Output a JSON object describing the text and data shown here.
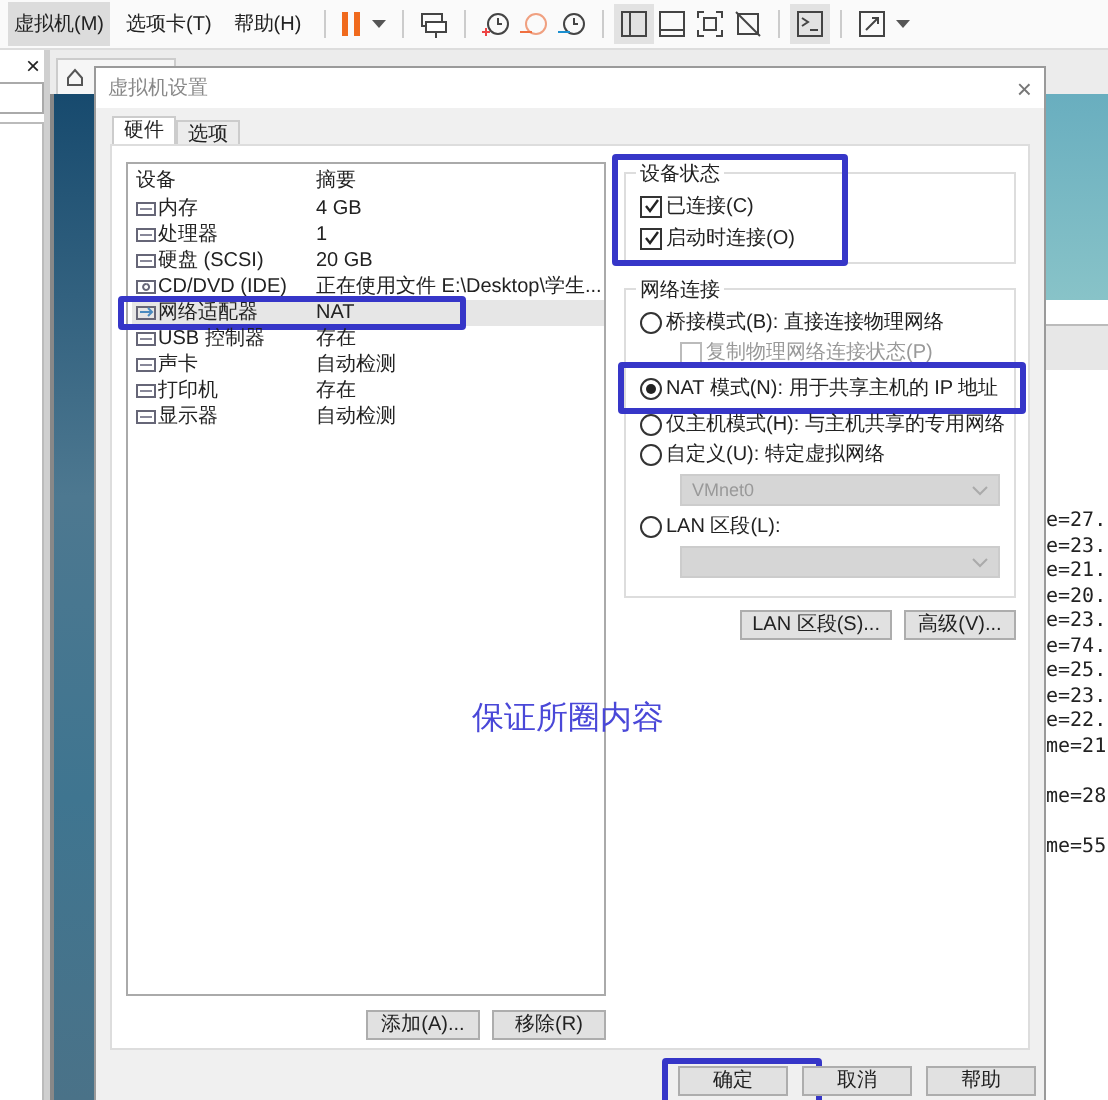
{
  "menu_bar": {
    "items": [
      {
        "label": "虚拟机(M)",
        "selected": true
      },
      {
        "label": "选项卡(T)",
        "selected": false
      },
      {
        "label": "帮助(H)",
        "selected": false
      }
    ]
  },
  "library_panel": {
    "close": "×"
  },
  "console_blocks": [
    [
      "e=27.",
      "e=23.",
      "e=21.",
      "e=20.",
      "e=23.",
      "e=74.",
      "e=25.",
      "e=23.",
      "e=22.",
      "me=21"
    ],
    [
      "me=28"
    ],
    [
      "me=55"
    ]
  ],
  "dialog": {
    "title": "虚拟机设置",
    "close": "×",
    "tabs": [
      {
        "label": "硬件",
        "selected": true
      },
      {
        "label": "选项",
        "selected": false
      }
    ],
    "devices": {
      "columns": [
        "设备",
        "摘要"
      ],
      "rows": [
        {
          "name": "内存",
          "summary": "4 GB",
          "selected": false
        },
        {
          "name": "处理器",
          "summary": "1",
          "selected": false
        },
        {
          "name": "硬盘 (SCSI)",
          "summary": "20 GB",
          "selected": false
        },
        {
          "name": "CD/DVD (IDE)",
          "summary": "正在使用文件 E:\\Desktop\\学生...",
          "selected": false
        },
        {
          "name": "网络适配器",
          "summary": "NAT",
          "selected": true
        },
        {
          "name": "USB 控制器",
          "summary": "存在",
          "selected": false
        },
        {
          "name": "声卡",
          "summary": "自动检测",
          "selected": false
        },
        {
          "name": "打印机",
          "summary": "存在",
          "selected": false
        },
        {
          "name": "显示器",
          "summary": "自动检测",
          "selected": false
        }
      ]
    },
    "add_button": "添加(A)...",
    "remove_button": "移除(R)",
    "device_status": {
      "title": "设备状态",
      "options": [
        {
          "label": "已连接(C)",
          "checked": true
        },
        {
          "label": "启动时连接(O)",
          "checked": true
        }
      ]
    },
    "network": {
      "title": "网络连接",
      "options": [
        {
          "kind": "radio",
          "label": "桥接模式(B): 直接连接物理网络",
          "selected": false
        },
        {
          "kind": "checkbox",
          "label": "复制物理网络连接状态(P)",
          "checked": false,
          "disabled": true
        },
        {
          "kind": "radio",
          "label": "NAT 模式(N): 用于共享主机的 IP 地址",
          "selected": true
        },
        {
          "kind": "radio",
          "label": "仅主机模式(H): 与主机共享的专用网络",
          "selected": false
        },
        {
          "kind": "radio",
          "label": "自定义(U): 特定虚拟网络",
          "selected": false
        },
        {
          "kind": "select",
          "value": "VMnet0",
          "disabled": true
        },
        {
          "kind": "radio",
          "label": "LAN 区段(L):",
          "selected": false
        },
        {
          "kind": "select",
          "disabled": true
        }
      ]
    },
    "lan_button": "LAN 区段(S)...",
    "advanced_button": "高级(V)...",
    "footer_buttons": [
      "确定",
      "取消",
      "帮助"
    ]
  },
  "annotation": {
    "text": "保证所圈内容"
  }
}
